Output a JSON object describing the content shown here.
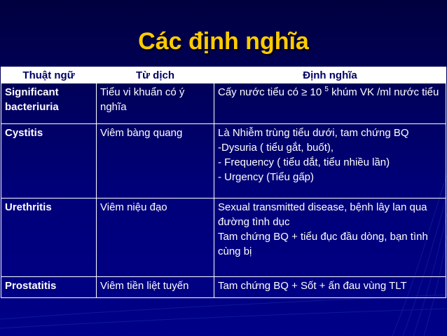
{
  "slide": {
    "title": "Các định nghĩa",
    "columns": [
      "Thuật ngữ",
      "Từ dịch",
      "Định nghĩa"
    ],
    "rows": [
      {
        "term": "Significant bacteriuria",
        "translation": "Tiểu vi khuẩn có ý nghĩa",
        "definition_before_sup": "Cấy nước tiểu có ≥ 10",
        "definition_sup": "5",
        "definition_after_sup": " khúm VK /ml nước tiểu"
      },
      {
        "term": "Cystitis",
        "translation": "Viêm bàng quang",
        "definition_lines": [
          "Là Nhiễm trùng tiểu dưới, tam chứng BQ",
          "-Dysuria ( tiểu gắt, buốt),",
          "- Frequency ( tiểu dắt, tiểu nhiều lần)",
          "- Urgency (Tiểu gấp)"
        ]
      },
      {
        "term": "Urethritis",
        "translation": "Viêm niệu đạo",
        "definition_lines": [
          "Sexual transmitted disease, bệnh lây lan qua  đường tình dục",
          "Tam chứng BQ + tiểu đục đầu dòng, bạn tình cùng bị"
        ]
      },
      {
        "term": "Prostatitis",
        "translation": "Viêm tiền liệt tuyến",
        "definition": "Tam chứng BQ + Sốt + ấn đau vùng TLT"
      }
    ]
  },
  "colors": {
    "background": "#000078",
    "title": "#ffcc00",
    "header_bg": "#ffffff",
    "header_text": "#000066",
    "cell_text": "#ffffff"
  }
}
